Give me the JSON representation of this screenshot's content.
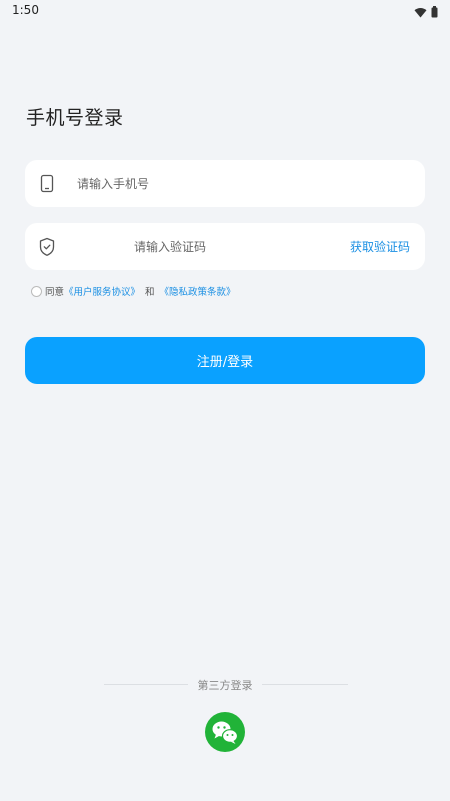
{
  "status_bar": {
    "time": "1:50",
    "icons": [
      "wifi-icon",
      "battery-icon"
    ]
  },
  "page": {
    "title": "手机号登录"
  },
  "phone_field": {
    "placeholder": "请输入手机号",
    "value": "",
    "icon": "phone-icon"
  },
  "code_field": {
    "placeholder": "请输入验证码",
    "value": "",
    "icon": "shield-icon",
    "get_code_label": "获取验证码"
  },
  "agreement": {
    "prefix": "同意",
    "terms_link": "《用户服务协议》",
    "joiner": "和",
    "privacy_link": "《隐私政策条款》",
    "checked": false
  },
  "submit": {
    "label": "注册/登录"
  },
  "third_party": {
    "label": "第三方登录",
    "providers": [
      "wechat-icon"
    ]
  },
  "colors": {
    "background": "#f2f4f7",
    "accent": "#0aa1ff",
    "link": "#1a8fe3",
    "wechat": "#21b338"
  }
}
